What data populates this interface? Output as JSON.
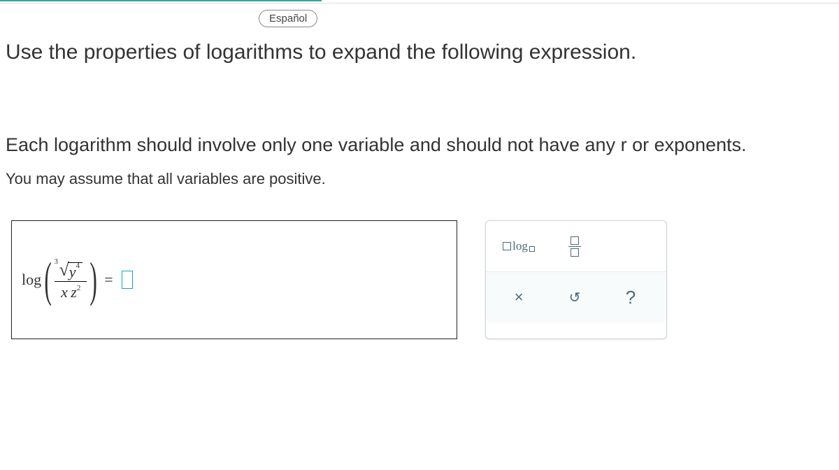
{
  "language_button": "Español",
  "instruction_main": "Use the properties of logarithms to expand the following expression.",
  "instruction_detail": "Each logarithm should involve only one variable and should not have any r or exponents.",
  "instruction_assume": "You may assume that all variables are positive.",
  "math": {
    "operator": "log",
    "root_index": "3",
    "inner_base": "y",
    "inner_exp": "4",
    "denom_v1": "x",
    "denom_v2": "z",
    "denom_exp": "2",
    "equals": "="
  },
  "tools": {
    "log_label": "log",
    "clear": "×",
    "undo": "↺",
    "help": "?"
  }
}
